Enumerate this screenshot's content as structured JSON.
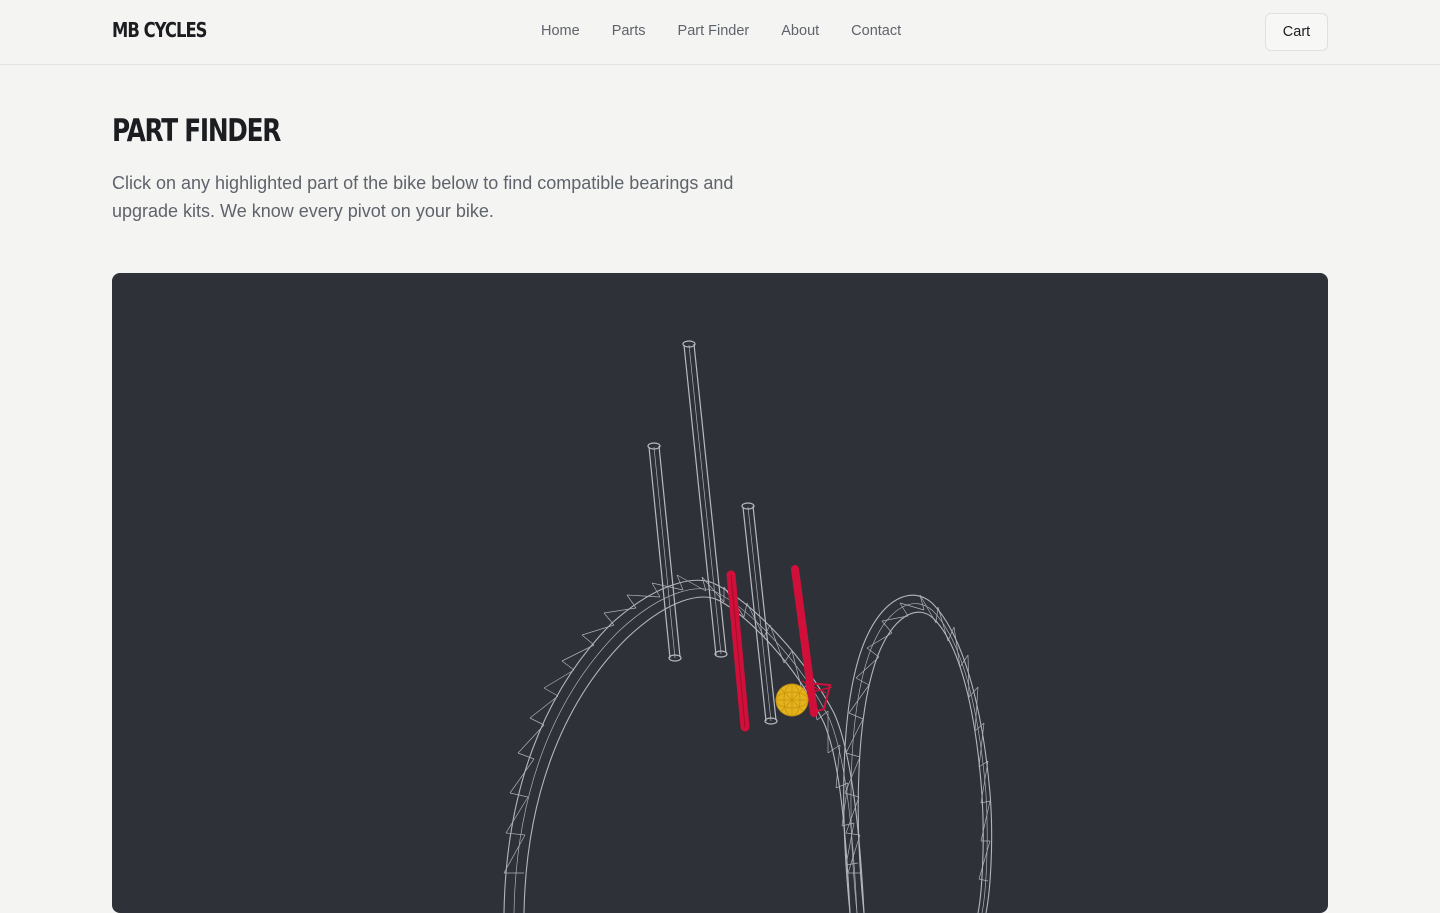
{
  "header": {
    "logo": "MB CYCLES",
    "nav": [
      "Home",
      "Parts",
      "Part Finder",
      "About",
      "Contact"
    ],
    "cart_label": "Cart"
  },
  "main": {
    "title": "PART FINDER",
    "intro": "Click on any highlighted part of the bike below to find compatible bearings and upgrade kits. We know every pivot on your bike."
  },
  "viewer": {
    "background_color": "#2e3138",
    "wire_color": "#b3b6bc",
    "highlight_color": "#d0103a",
    "bearing_color": "#e3b21c"
  }
}
